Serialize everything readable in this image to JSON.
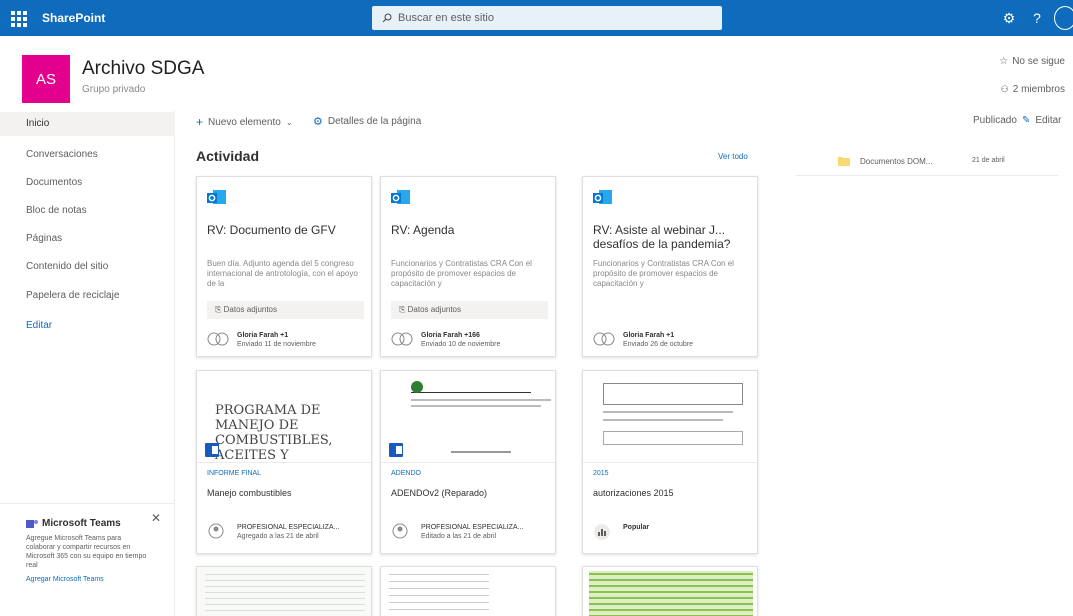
{
  "suite": {
    "brand": "SharePoint",
    "search_placeholder": "Buscar en este sitio"
  },
  "site": {
    "logo_initials": "AS",
    "title": "Archivo SDGA",
    "subtitle": "Grupo privado",
    "follow_label": "No se sigue",
    "members_label": "2 miembros"
  },
  "nav": {
    "items": [
      {
        "label": "Inicio"
      },
      {
        "label": "Conversaciones"
      },
      {
        "label": "Documentos"
      },
      {
        "label": "Bloc de notas"
      },
      {
        "label": "Páginas"
      },
      {
        "label": "Contenido del sitio"
      },
      {
        "label": "Papelera de reciclaje"
      },
      {
        "label": "Editar"
      }
    ]
  },
  "teams": {
    "title": "Microsoft Teams",
    "text": "Agregue Microsoft Teams para colaborar y compartir recursos en Microsoft 365 con su equipo en tiempo real",
    "link": "Agregar Microsoft Teams"
  },
  "commandbar": {
    "new_item": "Nuevo elemento",
    "page_details": "Detalles de la página",
    "published": "Publicado",
    "edit": "Editar"
  },
  "activity": {
    "title": "Actividad",
    "see_all": "Ver todo",
    "mail_cards": [
      {
        "title": "RV: Documento de GFV",
        "snippet": "Buen día. Adjunto agenda del 5 congreso internacional de antrotología, con el apoyo de la",
        "attachment": "Datos adjuntos",
        "author": "Gloria Farah +1",
        "date": "Enviado 11 de noviembre"
      },
      {
        "title": "RV: Agenda",
        "snippet": "Funcionarios y Contratistas CRA Con el propósito de promover espacios de capacitación y",
        "attachment": "Datos adjuntos",
        "author": "Gloria Farah +166",
        "date": "Enviado 10 de noviembre"
      },
      {
        "title": "RV: Asiste al webinar J... desafíos de la pandemia?",
        "snippet": "Funcionarios y Contratistas CRA Con el propósito de promover espacios de capacitación y",
        "attachment": "",
        "author": "Gloria Farah +1",
        "date": "Enviado 26 de octubre"
      }
    ],
    "doc_cards": [
      {
        "preview_text": "PROGRAMA DE MANEJO DE COMBUSTIBLES, ACEITES Y",
        "category": "INFORME FINAL",
        "title": "Manejo combustibles",
        "author": "PROFESIONAL ESPECIALIZA...",
        "date": "Agregado a las 21 de abril"
      },
      {
        "category": "ADENDO",
        "title": "ADENDOv2 (Reparado)",
        "author": "PROFESIONAL ESPECIALIZA...",
        "date": "Editado a las 21 de abril"
      },
      {
        "category": "2015",
        "title": "autorizaciones 2015",
        "author": "Popular",
        "date": ""
      }
    ]
  },
  "side_doc": {
    "name": "Documentos DOM...",
    "date": "21 de abril"
  },
  "colors": {
    "suite": "#0f6cbd",
    "logo": "#e3008c",
    "link": "#0f6cbd"
  }
}
